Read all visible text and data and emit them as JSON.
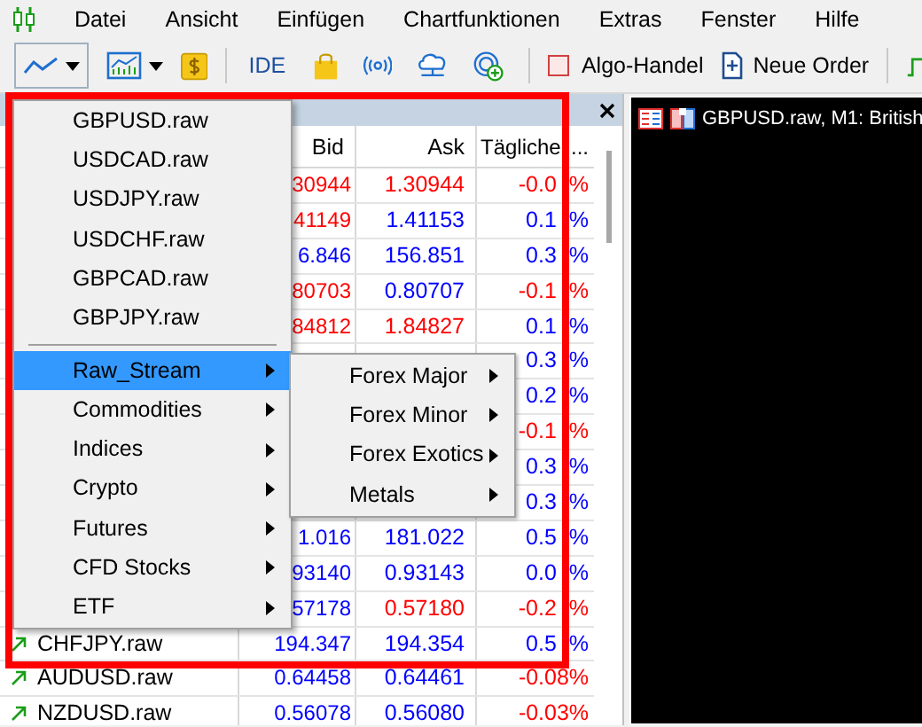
{
  "menubar": [
    "Datei",
    "Ansicht",
    "Einfügen",
    "Chartfunktionen",
    "Extras",
    "Fenster",
    "Hilfe"
  ],
  "toolbar": {
    "ide": "IDE",
    "algo": {
      "label": "Algo-Handel",
      "on": false
    },
    "order": "Neue Order"
  },
  "table": {
    "columns": [
      "Bid",
      "Ask",
      "Tägliche",
      "..."
    ],
    "rows": [
      {
        "bid": "30944",
        "bid_down": true,
        "ask": "1.30944",
        "ask_down": true,
        "change": "-0.0",
        "change_down": true,
        "unit": "%"
      },
      {
        "bid": "41149",
        "bid_down": true,
        "ask": "1.41153",
        "ask_down": false,
        "change": "0.1",
        "change_down": false,
        "unit": "%"
      },
      {
        "bid": "6.846",
        "bid_down": false,
        "ask": "156.851",
        "ask_down": false,
        "change": "0.3",
        "change_down": false,
        "unit": "%"
      },
      {
        "bid": "80703",
        "bid_down": true,
        "ask": "0.80707",
        "ask_down": false,
        "change": "-0.1",
        "change_down": true,
        "unit": "%"
      },
      {
        "bid": "84812",
        "bid_down": true,
        "ask": "1.84827",
        "ask_down": true,
        "change": "0.1",
        "change_down": false,
        "unit": "%"
      },
      {
        "change": "0.3",
        "change_down": false,
        "unit": "%"
      },
      {
        "change": "0.2",
        "change_down": false,
        "unit": "%"
      },
      {
        "change": "-0.1",
        "change_down": true,
        "unit": "%"
      },
      {
        "change": "0.3",
        "change_down": false,
        "unit": "%"
      },
      {
        "change": "0.3",
        "change_down": false,
        "unit": "%"
      },
      {
        "bid": "1.016",
        "bid_down": false,
        "ask": "181.022",
        "ask_down": false,
        "change": "0.5",
        "change_down": false,
        "unit": "%"
      },
      {
        "bid": "93140",
        "bid_down": false,
        "ask": "0.93143",
        "ask_down": false,
        "change": "0.0",
        "change_down": false,
        "unit": "%"
      },
      {
        "bid": "57178",
        "bid_down": false,
        "ask": "0.57180",
        "ask_down": true,
        "change": "-0.2",
        "change_down": true,
        "unit": "%"
      },
      {
        "rising": true,
        "symbol": "CHFJPY.raw",
        "bid": "194.347",
        "bid_down": false,
        "ask": "194.354",
        "ask_down": false,
        "change": "0.5",
        "change_down": false,
        "unit": "%"
      },
      {
        "rising": true,
        "symbol": "AUDUSD.raw",
        "bid": "0.64458",
        "bid_down": false,
        "ask": "0.64461",
        "ask_down": false,
        "change": "-0.08%",
        "change_down": true
      },
      {
        "rising": true,
        "symbol": "NZDUSD.raw",
        "bid": "0.56078",
        "bid_down": false,
        "ask": "0.56080",
        "ask_down": false,
        "change": "-0.03%",
        "change_down": true
      }
    ]
  },
  "context_menu": {
    "items": [
      {
        "kind": "item",
        "label": "GBPUSD.raw",
        "selected": false
      },
      {
        "kind": "item",
        "label": "USDCAD.raw",
        "selected": false
      },
      {
        "kind": "item",
        "label": "USDJPY.raw",
        "selected": false
      },
      {
        "kind": "item",
        "label": "USDCHF.raw",
        "selected": false
      },
      {
        "kind": "item",
        "label": "GBPCAD.raw",
        "selected": false
      },
      {
        "kind": "item",
        "label": "GBPJPY.raw",
        "selected": false
      },
      {
        "kind": "separator"
      },
      {
        "kind": "submenu",
        "label": "Raw_Stream",
        "selected": true
      },
      {
        "kind": "submenu",
        "label": "Commodities",
        "selected": false
      },
      {
        "kind": "submenu",
        "label": "Indices",
        "selected": false
      },
      {
        "kind": "submenu",
        "label": "Crypto",
        "selected": false
      },
      {
        "kind": "submenu",
        "label": "Futures",
        "selected": false
      },
      {
        "kind": "submenu",
        "label": "CFD Stocks",
        "selected": false
      },
      {
        "kind": "submenu",
        "label": "ETF",
        "selected": false
      }
    ]
  },
  "submenu": {
    "items": [
      {
        "kind": "submenu",
        "label": "Forex Major",
        "selected": false
      },
      {
        "kind": "submenu",
        "label": "Forex Minor",
        "selected": false
      },
      {
        "kind": "submenu",
        "label": "Forex Exotics",
        "selected": false
      },
      {
        "kind": "submenu",
        "label": "Metals",
        "selected": false
      }
    ]
  },
  "chart": {
    "title": "GBPUSD.raw, M1:  British"
  }
}
